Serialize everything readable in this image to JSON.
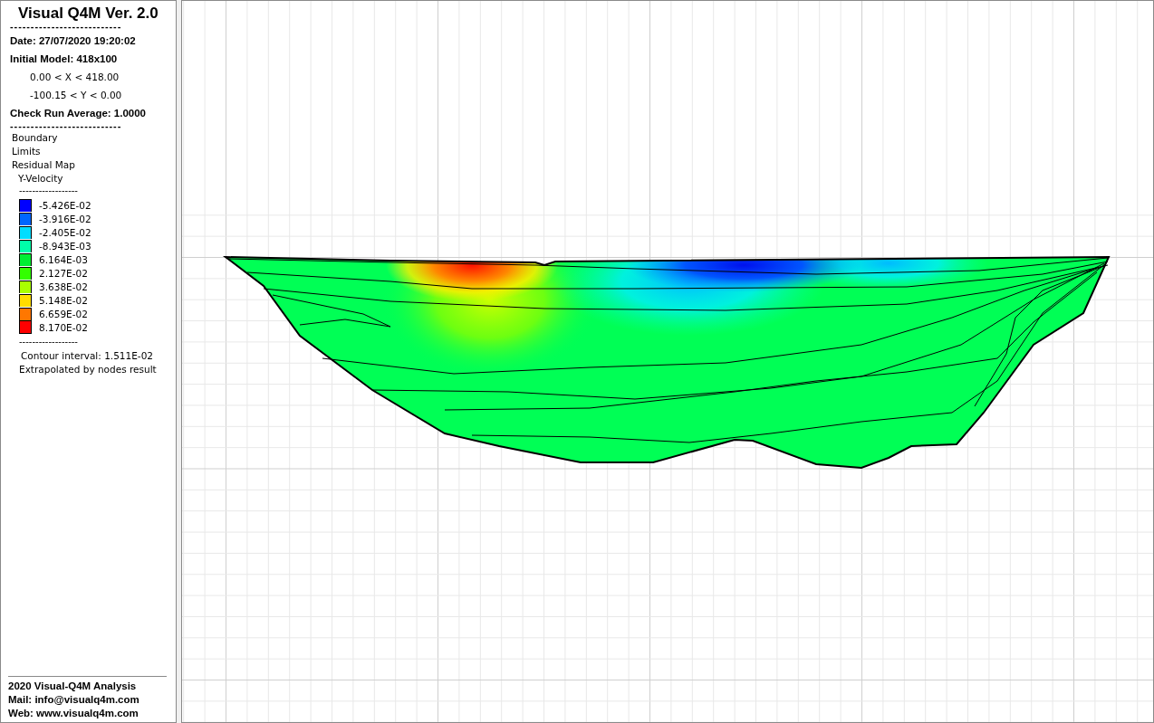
{
  "panel": {
    "title": "Visual Q4M Ver. 2.0",
    "separator_top": "---------------------------",
    "date": "Date: 27/07/2020 19:20:02",
    "model": "Initial Model: 418x100",
    "x_range": "0.00 < X < 418.00",
    "y_range": "-100.15 < Y < 0.00",
    "check_run": "Check Run Average: 1.0000",
    "separator_mid": "---------------------------",
    "layers": [
      "Boundary",
      "Limits",
      "Residual Map"
    ],
    "variable": "Y-Velocity",
    "legend_separator_top": "------------------",
    "legend": [
      {
        "label": "-5.426E-02",
        "color": "#0000ff"
      },
      {
        "label": "-3.916E-02",
        "color": "#0066ff"
      },
      {
        "label": "-2.405E-02",
        "color": "#00ddff"
      },
      {
        "label": "-8.943E-03",
        "color": "#00ffaa"
      },
      {
        "label": "6.164E-03",
        "color": "#00ee33"
      },
      {
        "label": "2.127E-02",
        "color": "#33ff00"
      },
      {
        "label": "3.638E-02",
        "color": "#aaff00"
      },
      {
        "label": "5.148E-02",
        "color": "#ffdd00"
      },
      {
        "label": "6.659E-02",
        "color": "#ff7700"
      },
      {
        "label": "8.170E-02",
        "color": "#ff0000"
      }
    ],
    "legend_separator_bottom": "------------------",
    "contour_interval": "Contour interval: 1.511E-02",
    "method": "Extrapolated by nodes result",
    "footer": [
      "2020 Visual-Q4M Analysis",
      "Mail: info@visualq4m.com",
      "Web: www.visualq4m.com"
    ]
  }
}
